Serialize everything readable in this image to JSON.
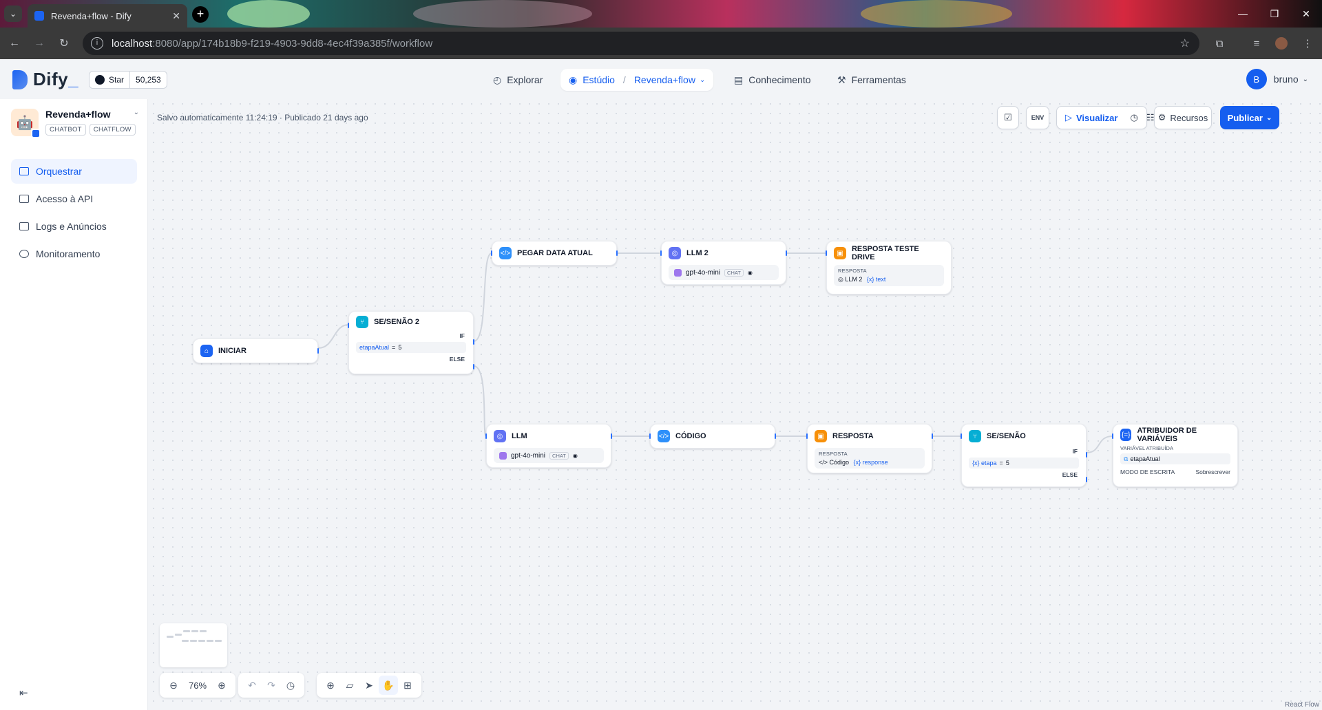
{
  "browser": {
    "tab_title": "Revenda+flow - Dify",
    "tab_close": "✕",
    "tab_dropdown": "⌄",
    "new_tab": "+",
    "url_host": "localhost",
    "url_path": ":8080/app/174b18b9-f219-4903-9dd8-4ec4f39a385f/workflow",
    "window_controls": [
      "—",
      "❐",
      "✕"
    ]
  },
  "header": {
    "logo": "Dify",
    "github": {
      "label": "Star",
      "count": "50,253"
    },
    "nav": {
      "explore": "Explorar",
      "studio": "Estúdio",
      "studio_sep": "/",
      "studio_app": "Revenda+flow",
      "knowledge": "Conhecimento",
      "tools": "Ferramentas"
    },
    "user": {
      "initial": "B",
      "name": "bruno"
    }
  },
  "sidebar": {
    "app_name": "Revenda+flow",
    "tags": [
      "CHATBOT",
      "CHATFLOW"
    ],
    "items": [
      {
        "label": "Orquestrar",
        "active": true
      },
      {
        "label": "Acesso à API",
        "active": false
      },
      {
        "label": "Logs e Anúncios",
        "active": false
      },
      {
        "label": "Monitoramento",
        "active": false
      }
    ]
  },
  "canvas": {
    "save_status": "Salvo automaticamente 11:24:19 · Publicado 21 days ago",
    "toolbar": {
      "env": "ENV",
      "preview": "Visualizar",
      "features": "Recursos",
      "publish": "Publicar"
    },
    "nodes": {
      "start": {
        "title": "INICIAR"
      },
      "ifelse2": {
        "title": "SE/SENÃO 2",
        "if_label": "IF",
        "else_label": "ELSE",
        "cond_var": "etapaAtual",
        "cond_op": "=",
        "cond_val": "5"
      },
      "getdate": {
        "title": "PEGAR DATA ATUAL"
      },
      "llm2": {
        "title": "LLM 2",
        "model": "gpt-4o-mini",
        "mode": "CHAT"
      },
      "resp_drive": {
        "title": "RESPOSTA TESTE DRIVE",
        "label": "RESPOSTA",
        "src": "LLM 2",
        "var": "{x} text"
      },
      "llm": {
        "title": "LLM",
        "model": "gpt-4o-mini",
        "mode": "CHAT"
      },
      "code": {
        "title": "CÓDIGO"
      },
      "resp": {
        "title": "RESPOSTA",
        "label": "RESPOSTA",
        "src": "Código",
        "var": "{x} response"
      },
      "ifelse": {
        "title": "SE/SENÃO",
        "if_label": "IF",
        "else_label": "ELSE",
        "cond_var": "{x} etapa",
        "cond_op": "=",
        "cond_val": "5"
      },
      "assigner": {
        "title": "ATRIBUIDOR DE VARIÁVEIS",
        "assigned_label": "VARIÁVEL ATRIBUÍDA",
        "assigned_var": "etapaAtual",
        "mode_label": "MODO DE ESCRITA",
        "mode_value": "Sobrescrever"
      }
    },
    "zoom": "76%",
    "attribution": "React Flow"
  },
  "colors": {
    "accent": "#155eef",
    "canvas_bg": "#f2f4f7"
  }
}
